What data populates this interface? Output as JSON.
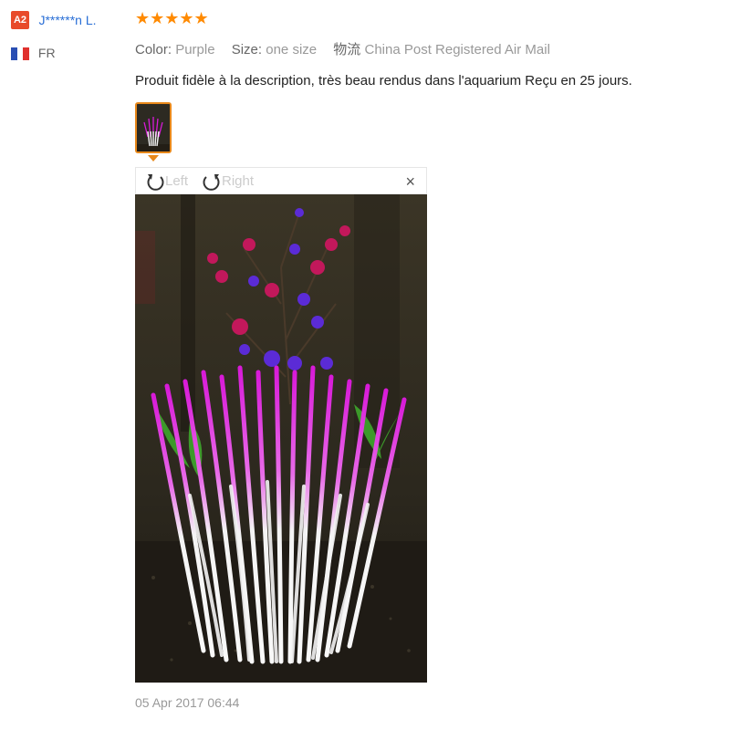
{
  "user": {
    "avatar_initials": "A2",
    "name": "J******n L.",
    "country_code": "FR",
    "flag_colors": [
      "#2a4fb3",
      "#ffffff",
      "#e0312e"
    ]
  },
  "review": {
    "rating": 5,
    "stars_text": "★★★★★",
    "color_label": "Color:",
    "color_value": "Purple",
    "size_label": "Size:",
    "size_value": "one size",
    "shipping_label": "物流",
    "shipping_value": "China Post Registered Air Mail",
    "text": "Produit fidèle à la description, très beau rendus dans l'aquarium Reçu en 25 jours.",
    "date": "05 Apr 2017 06:44"
  },
  "viewer": {
    "rotate_left_label": "Left",
    "rotate_right_label": "Right",
    "close_label": "×"
  },
  "colors": {
    "accent_orange": "#e8881a",
    "star_orange": "#ff8a00",
    "username_blue": "#2a6fd6",
    "badge_red": "#e84a2a",
    "plant_magenta": "#d81ad8"
  }
}
